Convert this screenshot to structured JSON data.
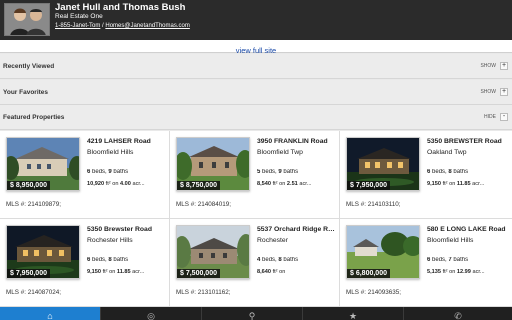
{
  "header": {
    "agent_name": "Janet Hull and Thomas Bush",
    "company": "Real Estate One",
    "phone": "1-855-Janet-Tom",
    "separator": " / ",
    "email": "Homes@JanetandThomas.com"
  },
  "full_site_link": "view full site",
  "sections": {
    "recently_viewed": {
      "title": "Recently Viewed",
      "toggle": "SHOW",
      "button": "+"
    },
    "favorites": {
      "title": "Your Favorites",
      "toggle": "SHOW",
      "button": "+"
    },
    "featured": {
      "title": "Featured Properties",
      "toggle": "HIDE",
      "button": "-"
    }
  },
  "properties": [
    {
      "address": "4219 LAHSER Road",
      "city": "Bloomfield Hills",
      "price": "$ 8,950,000",
      "beds": "6",
      "baths": "9",
      "sqft": "10,920",
      "acres": "4.00",
      "mls": "MLS #: 214109879;"
    },
    {
      "address": "3950 FRANKLIN Road",
      "city": "Bloomfield Twp",
      "price": "$ 8,750,000",
      "beds": "5",
      "baths": "9",
      "sqft": "8,540",
      "acres": "2.51",
      "mls": "MLS #: 214084019;"
    },
    {
      "address": "5350 BREWSTER Road",
      "city": "Oakland Twp",
      "price": "$ 7,950,000",
      "beds": "6",
      "baths": "8",
      "sqft": "9,150",
      "acres": "11.85",
      "mls": "MLS #: 214103110;"
    },
    {
      "address": "5350 Brewster Road",
      "city": "Rochester Hills",
      "price": "$ 7,950,000",
      "beds": "6",
      "baths": "8",
      "sqft": "9,150",
      "acres": "11.85",
      "mls": "MLS #: 214087024;"
    },
    {
      "address": "5537 Orchard Ridge Road",
      "city": "Rochester",
      "price": "$ 7,500,000",
      "beds": "4",
      "baths": "8",
      "sqft": "8,640",
      "acres": "",
      "mls": "MLS #: 213101162;"
    },
    {
      "address": "580 E LONG LAKE Road",
      "city": "Bloomfield Hills",
      "price": "$ 6,800,000",
      "beds": "6",
      "baths": "7",
      "sqft": "5,135",
      "acres": "12.99",
      "mls": "MLS #: 214093635;"
    }
  ],
  "labels": {
    "beds": "beds",
    "baths": "baths",
    "sqft_unit": "ft²",
    "on": "on",
    "acres": "acr..."
  },
  "tabs": [
    {
      "name": "home-icon",
      "glyph": "⌂",
      "active": true
    },
    {
      "name": "search-compass-icon",
      "glyph": "◎",
      "active": false
    },
    {
      "name": "search-icon",
      "glyph": "⚲",
      "active": false
    },
    {
      "name": "star-icon",
      "glyph": "★",
      "active": false
    },
    {
      "name": "phone-icon",
      "glyph": "✆",
      "active": false
    }
  ],
  "colors": {
    "accent": "#1e7fd0",
    "header_bg": "#2b2b2b",
    "link": "#1a4aa8"
  }
}
